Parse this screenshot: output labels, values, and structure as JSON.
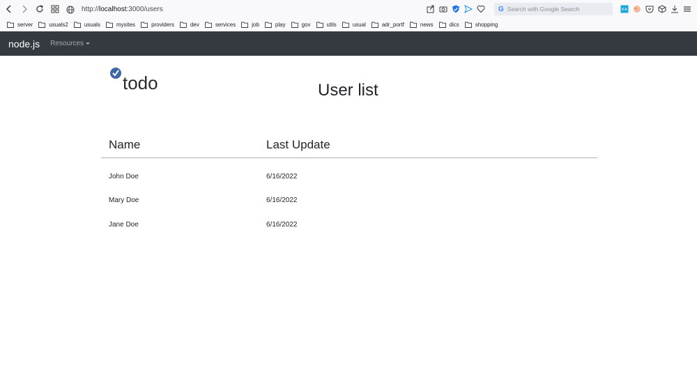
{
  "browser": {
    "url_prefix": "http://",
    "url_host": "localhost",
    "url_path": ":3000/users",
    "search_placeholder": "Search with Google Search"
  },
  "bookmarks": [
    "server",
    "usuals2",
    "usuals",
    "mysites",
    "providers",
    "dev",
    "services",
    "job",
    "play",
    "gov",
    "utils",
    "usual",
    "adr_portf",
    "news",
    "dics",
    "shopping"
  ],
  "navbar": {
    "brand": "node.js",
    "resources_label": "Resources"
  },
  "logo": {
    "text": "todo",
    "accent_color": "#3d68a8"
  },
  "page": {
    "title": "User list"
  },
  "table": {
    "headers": [
      "Name",
      "Last Update"
    ],
    "rows": [
      [
        "John Doe",
        "6/16/2022"
      ],
      [
        "Mary Doe",
        "6/16/2022"
      ],
      [
        "Jane Doe",
        "6/16/2022"
      ]
    ]
  }
}
